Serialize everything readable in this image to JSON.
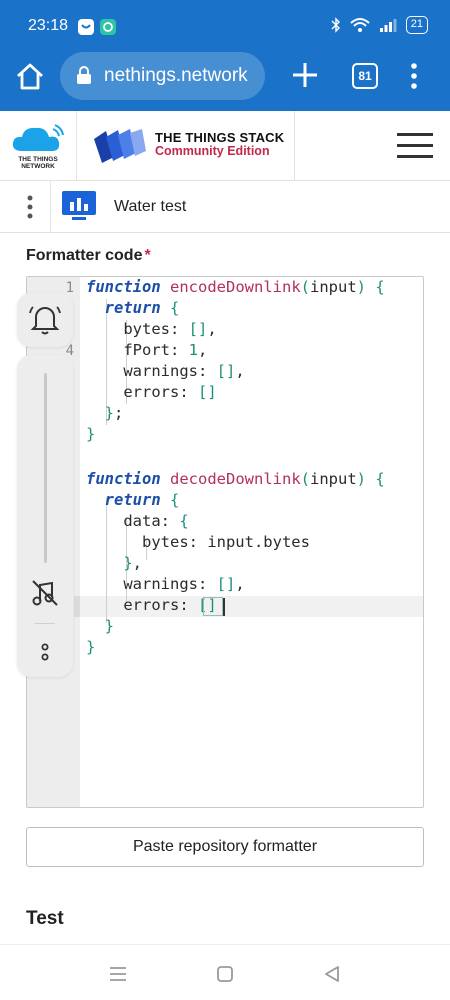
{
  "status_bar": {
    "time": "23:18",
    "battery": "21",
    "icons": [
      "bluetooth-icon",
      "wifi-icon",
      "signal-icon"
    ]
  },
  "browser": {
    "url": "nethings.network",
    "tab_count": "81"
  },
  "header": {
    "ttn_logo_text_1": "THE THINGS",
    "ttn_logo_text_2": "NETWORK",
    "product_title": "THE THINGS STACK",
    "product_subtitle": "Community Edition"
  },
  "breadcrumb": {
    "app_name": "Water test"
  },
  "formatter": {
    "label": "Formatter code",
    "required_mark": "*",
    "line_numbers": [
      "1",
      "4"
    ]
  },
  "actions": {
    "paste_label": "Paste repository formatter"
  },
  "test_section": {
    "title": "Test"
  },
  "colors": {
    "browser_blue": "#1a73c9",
    "brand_red": "#c2284a",
    "keyword_blue": "#1b4fa8",
    "function_pink": "#b3305a",
    "bracket_teal": "#1f8f7a"
  }
}
